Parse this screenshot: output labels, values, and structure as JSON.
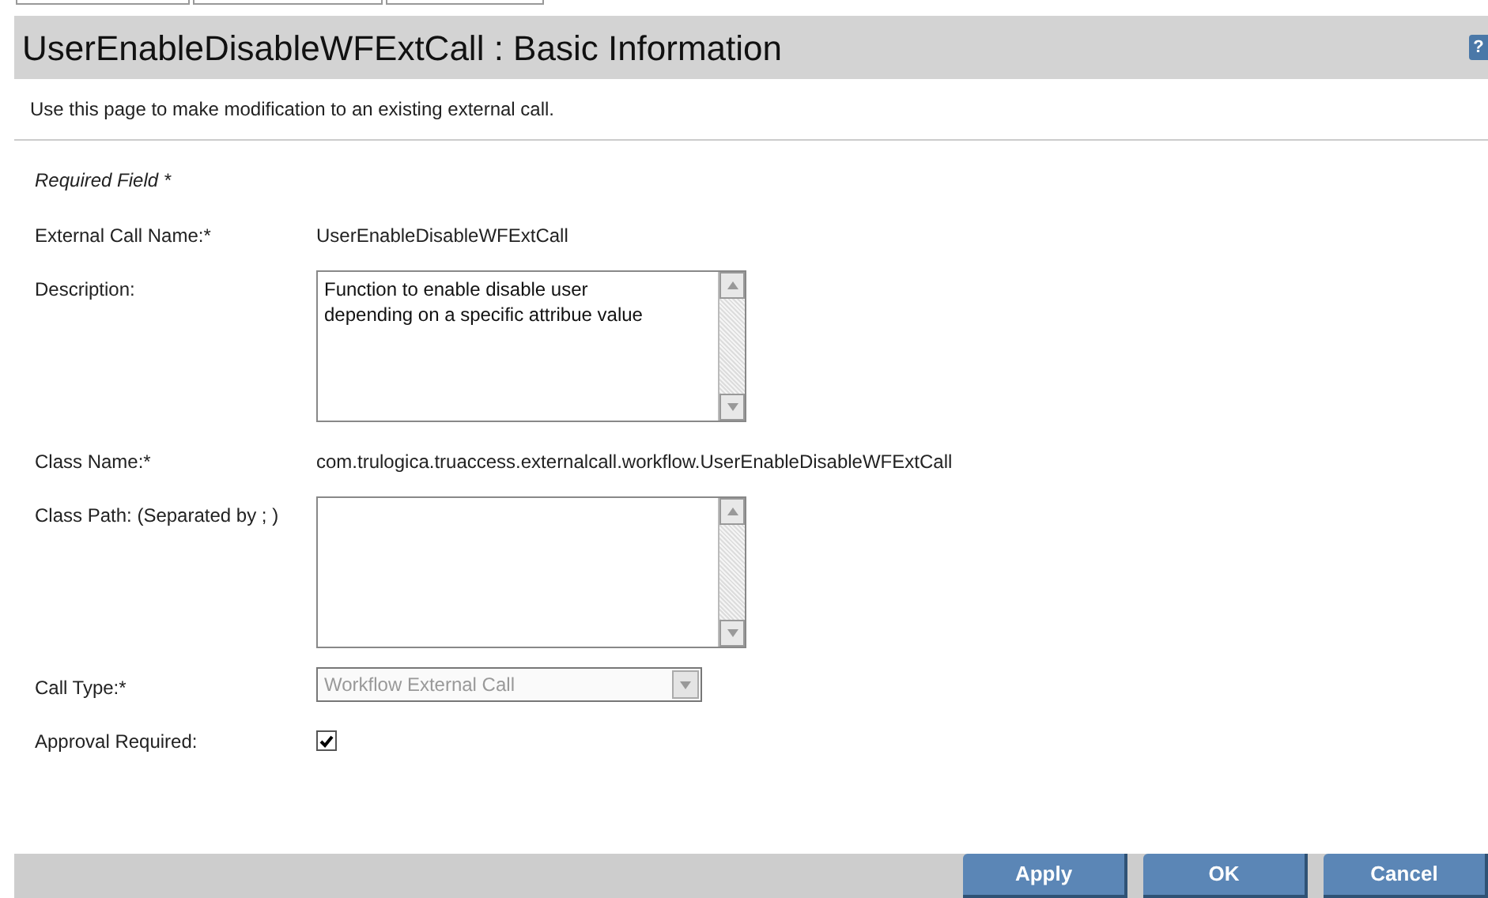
{
  "header": {
    "title": "UserEnableDisableWFExtCall : Basic Information",
    "help_icon": "?"
  },
  "intro": "Use this page to make modification to an existing external call.",
  "required_note": "Required Field *",
  "fields": [
    {
      "kind": "text",
      "label": "External Call Name:*",
      "value": "UserEnableDisableWFExtCall"
    },
    {
      "kind": "textarea",
      "label": "Description:",
      "value": "Function to enable disable user\ndepending on a specific attribue value"
    },
    {
      "kind": "text",
      "label": "Class Name:*",
      "value": "com.trulogica.truaccess.externalcall.workflow.UserEnableDisableWFExtCall"
    },
    {
      "kind": "textarea",
      "label": "Class Path: (Separated by ; )"
    },
    {
      "kind": "select",
      "label": "Call Type:*",
      "value": "Workflow External Call",
      "disabled": true
    },
    {
      "kind": "checkbox",
      "label": "Approval Required:",
      "checked": true
    }
  ],
  "buttons": [
    "Apply",
    "OK",
    "Cancel"
  ]
}
